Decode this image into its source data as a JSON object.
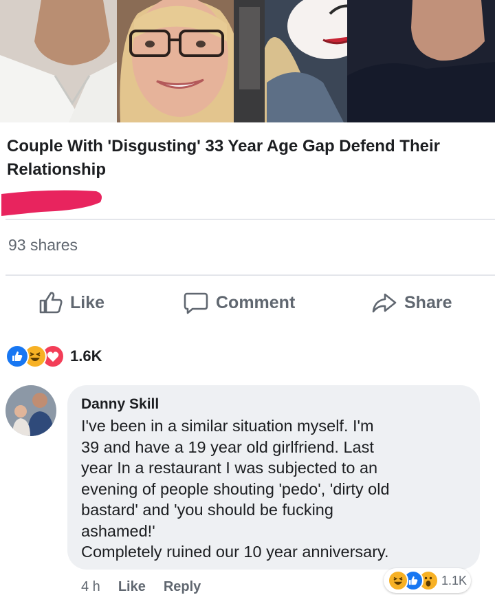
{
  "post": {
    "headline": "Couple With 'Disgusting' 33 Year Age Gap Defend Their Relationship",
    "shares": "93 shares"
  },
  "actions": {
    "like": "Like",
    "comment": "Comment",
    "share": "Share"
  },
  "reactions": {
    "types": [
      "like-icon",
      "haha-icon",
      "love-icon"
    ],
    "count": "1.6K"
  },
  "comment": {
    "author": "Danny Skill",
    "lines": [
      "I've been in a similar situation  myself. I'm",
      "39 and have a 19 year old girlfriend. Last",
      "year In a restaurant I was subjected to an",
      "evening of people shouting 'pedo', 'dirty old",
      "bastard' and 'you should be fucking",
      "ashamed!'",
      "Completely ruined our 10 year anniversary."
    ],
    "time": "4 h",
    "like_label": "Like",
    "reply_label": "Reply",
    "reactions": {
      "types": [
        "haha-icon",
        "like-icon",
        "wow-icon"
      ],
      "count": "1.1K"
    }
  },
  "colors": {
    "facebook_blue": "#1877f2",
    "love_red": "#f33e58",
    "haha_yellow": "#f7b125",
    "redaction_pink": "#e8245e",
    "secondary_text": "#606770",
    "bubble_bg": "#eef0f3"
  }
}
